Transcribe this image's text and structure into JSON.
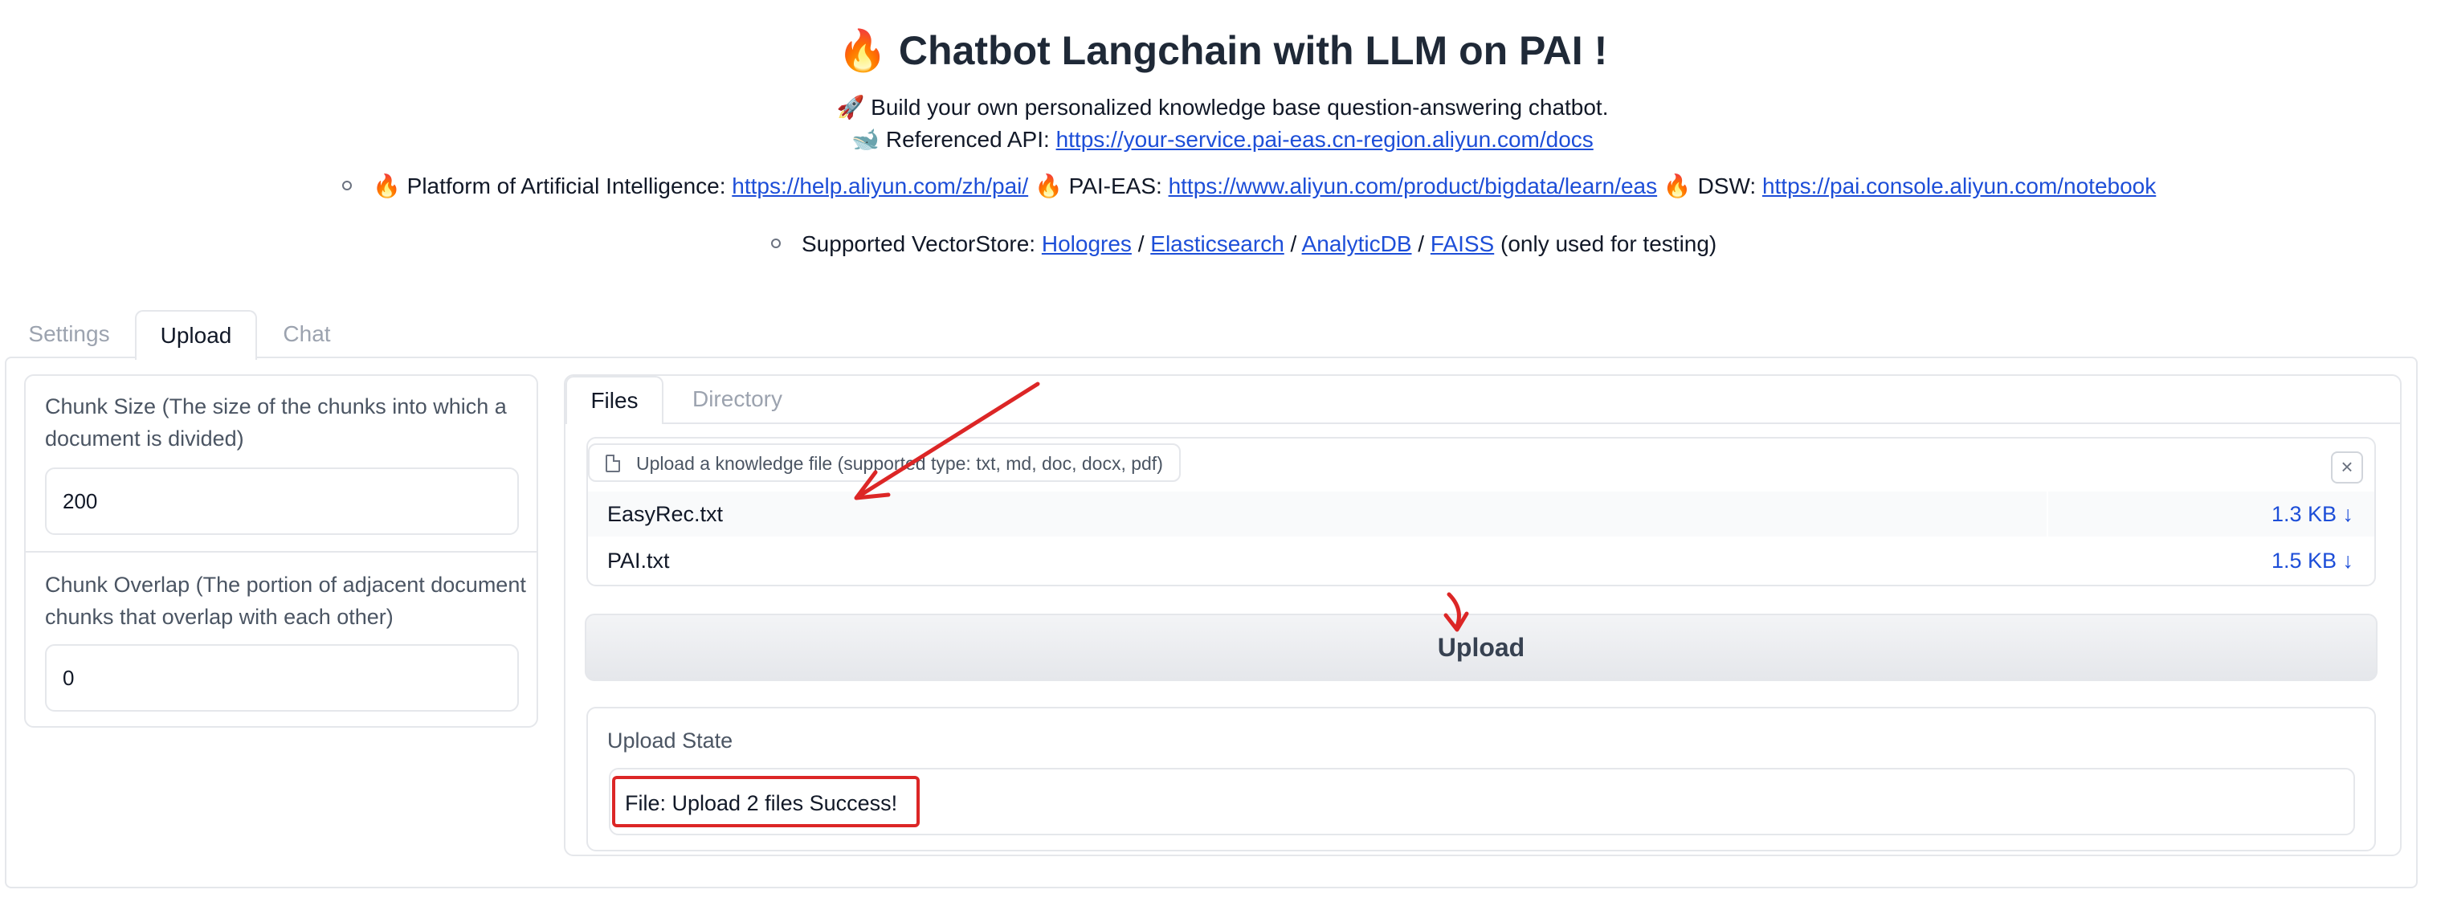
{
  "header": {
    "title_icon": "🔥",
    "title": "Chatbot Langchain with LLM on PAI !",
    "line1_icon": "🚀",
    "line1": "Build your own personalized knowledge base question-answering chatbot.",
    "line2_icon": "🐋",
    "line2_prefix": "Referenced API: ",
    "line2_link": "https://your-service.pai-eas.cn-region.aliyun.com/docs",
    "links_bullet": {
      "icon": "🔥",
      "pai_label": "Platform of Artificial Intelligence: ",
      "pai_url": "https://help.aliyun.com/zh/pai/",
      "eas_label": "PAI-EAS: ",
      "eas_url": "https://www.aliyun.com/product/bigdata/learn/eas",
      "dsw_label": "DSW: ",
      "dsw_url": "https://pai.console.aliyun.com/notebook"
    },
    "vector_bullet": {
      "prefix": "Supported VectorStore: ",
      "hologres": "Hologres",
      "elasticsearch": "Elasticsearch",
      "analyticdb": "AnalyticDB",
      "faiss": "FAISS",
      "slash": " / ",
      "suffix": " (only used for testing)"
    }
  },
  "tabs": [
    "Settings",
    "Upload",
    "Chat"
  ],
  "active_tab": "Upload",
  "left": {
    "chunk_size_label": "Chunk Size (The size of the chunks into which a document is divided)",
    "chunk_size_value": "200",
    "chunk_overlap_label": "Chunk Overlap (The portion of adjacent document chunks that overlap with each other)",
    "chunk_overlap_value": "0"
  },
  "right": {
    "inner_tabs": [
      "Files",
      "Directory"
    ],
    "file_chip": "Upload a knowledge file (supported type: txt, md, doc, docx, pdf)",
    "clear_icon": "×",
    "files": [
      {
        "name": "EasyRec.txt",
        "size": "1.3 KB ↓"
      },
      {
        "name": "PAI.txt",
        "size": "1.5 KB ↓"
      }
    ],
    "upload_button": "Upload",
    "upload_state_label": "Upload State",
    "upload_state_value": "File: Upload 2 files Success!"
  },
  "colors": {
    "link": "#1d4ed8",
    "annotation": "#dc2626",
    "border": "#e5e7eb"
  }
}
